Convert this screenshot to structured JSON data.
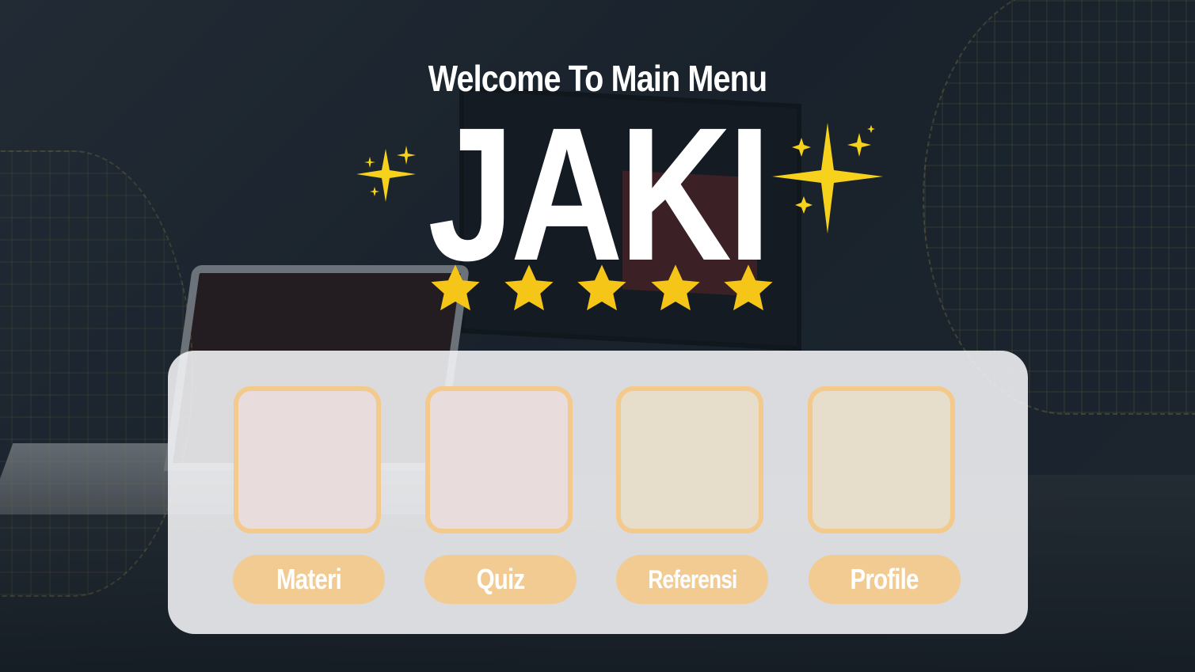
{
  "header": {
    "welcome": "Welcome To Main Menu",
    "title": "JAKI"
  },
  "rating": {
    "stars": 5
  },
  "menu": {
    "items": [
      {
        "label": "Materi",
        "card_color": "#e8dcdc"
      },
      {
        "label": "Quiz",
        "card_color": "#e8dcdc"
      },
      {
        "label": "Referensi",
        "card_color": "#e6ddca"
      },
      {
        "label": "Profile",
        "card_color": "#e6ddca"
      }
    ]
  },
  "colors": {
    "accent": "#f2cb93",
    "star": "#f5c518",
    "sparkle": "#f7d21c",
    "text": "#ffffff"
  }
}
